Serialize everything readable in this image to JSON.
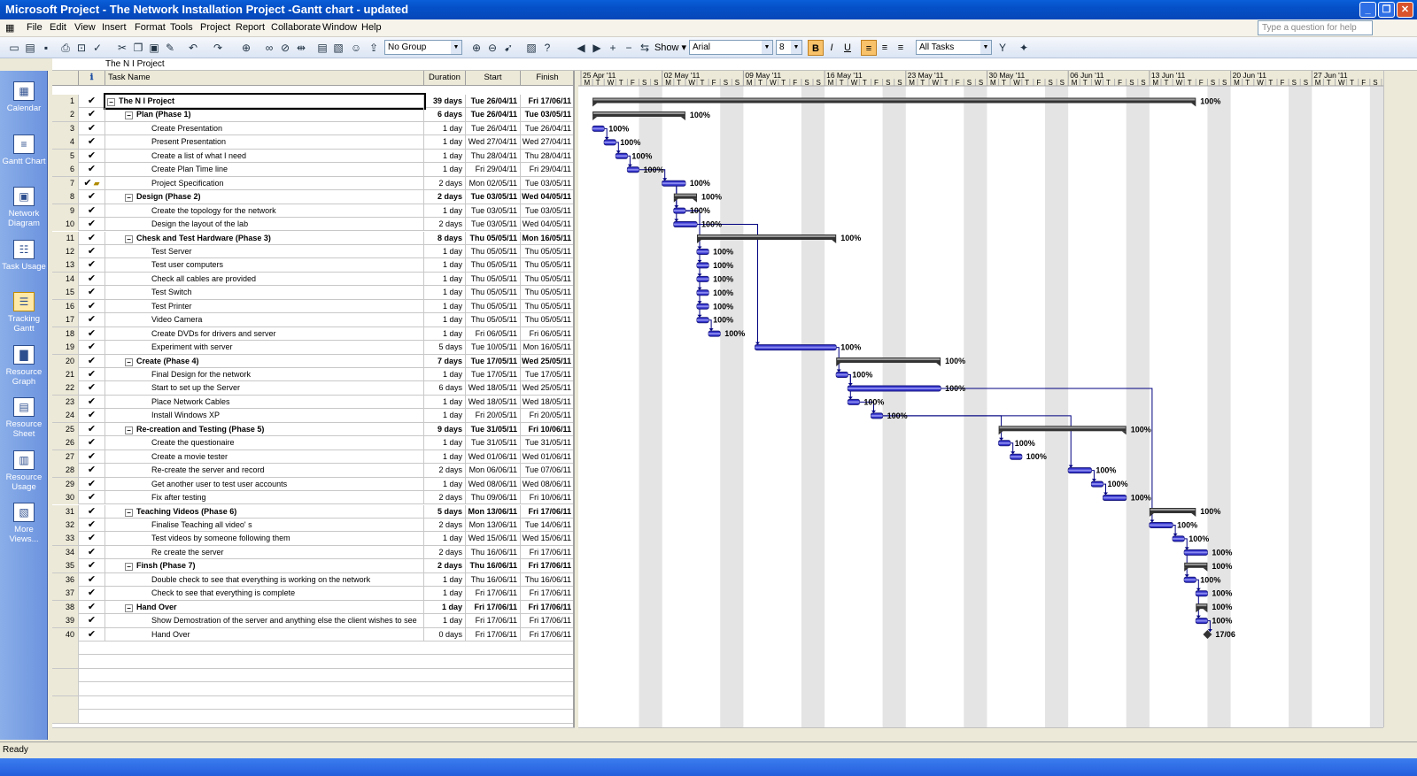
{
  "window": {
    "title": "Microsoft Project - The Network Installation Project -Gantt chart - updated"
  },
  "menu": [
    "File",
    "Edit",
    "View",
    "Insert",
    "Format",
    "Tools",
    "Project",
    "Report",
    "Collaborate",
    "Window",
    "Help"
  ],
  "help_placeholder": "Type a question for help",
  "toolbar": {
    "group_value": "No Group",
    "show_label": "Show ▾",
    "font": "Arial",
    "font_size": "8",
    "filter_value": "All Tasks",
    "bold": "B",
    "italic": "I",
    "underline": "U"
  },
  "entry_bar": "The N I Project",
  "view_bar": [
    {
      "label": "Calendar",
      "icon": "calendar-icon",
      "glyph": "▦"
    },
    {
      "label": "Gantt Chart",
      "icon": "gantt-chart-icon",
      "glyph": "≡"
    },
    {
      "label": "Network Diagram",
      "icon": "network-diagram-icon",
      "glyph": "▣"
    },
    {
      "label": "Task Usage",
      "icon": "task-usage-icon",
      "glyph": "☷"
    },
    {
      "label": "Tracking Gantt",
      "icon": "tracking-gantt-icon",
      "glyph": "☰"
    },
    {
      "label": "Resource Graph",
      "icon": "resource-graph-icon",
      "glyph": "▇"
    },
    {
      "label": "Resource Sheet",
      "icon": "resource-sheet-icon",
      "glyph": "▤"
    },
    {
      "label": "Resource Usage",
      "icon": "resource-usage-icon",
      "glyph": "▥"
    },
    {
      "label": "More Views...",
      "icon": "more-views-icon",
      "glyph": "▧"
    }
  ],
  "columns": {
    "info": "ℹ",
    "name": "Task Name",
    "duration": "Duration",
    "start": "Start",
    "finish": "Finish"
  },
  "weeks": [
    "25 Apr '11",
    "02 May '11",
    "09 May '11",
    "16 May '11",
    "23 May '11",
    "30 May '11",
    "06 Jun '11",
    "13 Jun '11",
    "20 Jun '11",
    "27 Jun '11"
  ],
  "day_letters": [
    "M",
    "T",
    "W",
    "T",
    "F",
    "S",
    "S"
  ],
  "tasks": [
    {
      "id": "1",
      "name": "The N I Project",
      "duration": "39 days",
      "start": "Tue 26/04/11",
      "finish": "Fri 17/06/11",
      "level": 0,
      "summary": true,
      "s": 1,
      "e": 53,
      "pct": "100%"
    },
    {
      "id": "2",
      "name": "Plan (Phase 1)",
      "duration": "6 days",
      "start": "Tue 26/04/11",
      "finish": "Tue 03/05/11",
      "level": 1,
      "summary": true,
      "s": 1,
      "e": 9,
      "pct": "100%"
    },
    {
      "id": "3",
      "name": "Create Presentation",
      "duration": "1 day",
      "start": "Tue 26/04/11",
      "finish": "Tue 26/04/11",
      "level": 2,
      "s": 1,
      "e": 2,
      "pct": "100%"
    },
    {
      "id": "4",
      "name": "Present Presentation",
      "duration": "1 day",
      "start": "Wed 27/04/11",
      "finish": "Wed 27/04/11",
      "level": 2,
      "s": 2,
      "e": 3,
      "pct": "100%"
    },
    {
      "id": "5",
      "name": "Create a list of what I need",
      "duration": "1 day",
      "start": "Thu 28/04/11",
      "finish": "Thu 28/04/11",
      "level": 2,
      "s": 3,
      "e": 4,
      "pct": "100%"
    },
    {
      "id": "6",
      "name": "Create Plan Time line",
      "duration": "1 day",
      "start": "Fri 29/04/11",
      "finish": "Fri 29/04/11",
      "level": 2,
      "s": 4,
      "e": 5,
      "pct": "100%"
    },
    {
      "id": "7",
      "name": "Project Specification",
      "duration": "2 days",
      "start": "Mon 02/05/11",
      "finish": "Tue 03/05/11",
      "level": 2,
      "note": true,
      "s": 7,
      "e": 9,
      "pct": "100%"
    },
    {
      "id": "8",
      "name": "Design (Phase 2)",
      "duration": "2 days",
      "start": "Tue 03/05/11",
      "finish": "Wed 04/05/11",
      "level": 1,
      "summary": true,
      "s": 8,
      "e": 10,
      "pct": "100%"
    },
    {
      "id": "9",
      "name": "Create the topology for the network",
      "duration": "1 day",
      "start": "Tue 03/05/11",
      "finish": "Tue 03/05/11",
      "level": 2,
      "s": 8,
      "e": 9,
      "pct": "100%"
    },
    {
      "id": "10",
      "name": "Design the layout of the lab",
      "duration": "2 days",
      "start": "Tue 03/05/11",
      "finish": "Wed 04/05/11",
      "level": 2,
      "s": 8,
      "e": 10,
      "pct": "100%"
    },
    {
      "id": "11",
      "name": "Chesk and Test Hardware (Phase 3)",
      "duration": "8 days",
      "start": "Thu 05/05/11",
      "finish": "Mon 16/05/11",
      "level": 1,
      "summary": true,
      "s": 10,
      "e": 22,
      "pct": "100%"
    },
    {
      "id": "12",
      "name": "Test Server",
      "duration": "1 day",
      "start": "Thu 05/05/11",
      "finish": "Thu 05/05/11",
      "level": 2,
      "s": 10,
      "e": 11,
      "pct": "100%"
    },
    {
      "id": "13",
      "name": "Test user computers",
      "duration": "1 day",
      "start": "Thu 05/05/11",
      "finish": "Thu 05/05/11",
      "level": 2,
      "s": 10,
      "e": 11,
      "pct": "100%"
    },
    {
      "id": "14",
      "name": "Check all cables are provided",
      "duration": "1 day",
      "start": "Thu 05/05/11",
      "finish": "Thu 05/05/11",
      "level": 2,
      "s": 10,
      "e": 11,
      "pct": "100%"
    },
    {
      "id": "15",
      "name": "Test Switch",
      "duration": "1 day",
      "start": "Thu 05/05/11",
      "finish": "Thu 05/05/11",
      "level": 2,
      "s": 10,
      "e": 11,
      "pct": "100%"
    },
    {
      "id": "16",
      "name": "Test Printer",
      "duration": "1 day",
      "start": "Thu 05/05/11",
      "finish": "Thu 05/05/11",
      "level": 2,
      "s": 10,
      "e": 11,
      "pct": "100%"
    },
    {
      "id": "17",
      "name": "Video Camera",
      "duration": "1 day",
      "start": "Thu 05/05/11",
      "finish": "Thu 05/05/11",
      "level": 2,
      "s": 10,
      "e": 11,
      "pct": "100%"
    },
    {
      "id": "18",
      "name": "Create DVDs for drivers and server",
      "duration": "1 day",
      "start": "Fri 06/05/11",
      "finish": "Fri 06/05/11",
      "level": 2,
      "s": 11,
      "e": 12,
      "pct": "100%"
    },
    {
      "id": "19",
      "name": "Experiment with server",
      "duration": "5 days",
      "start": "Tue 10/05/11",
      "finish": "Mon 16/05/11",
      "level": 2,
      "s": 15,
      "e": 22,
      "pct": "100%"
    },
    {
      "id": "20",
      "name": "Create (Phase 4)",
      "duration": "7 days",
      "start": "Tue 17/05/11",
      "finish": "Wed 25/05/11",
      "level": 1,
      "summary": true,
      "s": 22,
      "e": 31,
      "pct": "100%"
    },
    {
      "id": "21",
      "name": "Final Design for the network",
      "duration": "1 day",
      "start": "Tue 17/05/11",
      "finish": "Tue 17/05/11",
      "level": 2,
      "s": 22,
      "e": 23,
      "pct": "100%"
    },
    {
      "id": "22",
      "name": "Start to set up the Server",
      "duration": "6 days",
      "start": "Wed 18/05/11",
      "finish": "Wed 25/05/11",
      "level": 2,
      "s": 23,
      "e": 31,
      "pct": "100%"
    },
    {
      "id": "23",
      "name": "Place Network Cables",
      "duration": "1 day",
      "start": "Wed 18/05/11",
      "finish": "Wed 18/05/11",
      "level": 2,
      "s": 23,
      "e": 24,
      "pct": "100%"
    },
    {
      "id": "24",
      "name": "Install Windows XP",
      "duration": "1 day",
      "start": "Fri 20/05/11",
      "finish": "Fri 20/05/11",
      "level": 2,
      "s": 25,
      "e": 26,
      "pct": "100%"
    },
    {
      "id": "25",
      "name": "Re-creation and Testing (Phase 5)",
      "duration": "9 days",
      "start": "Tue 31/05/11",
      "finish": "Fri 10/06/11",
      "level": 1,
      "summary": true,
      "s": 36,
      "e": 47,
      "pct": "100%"
    },
    {
      "id": "26",
      "name": "Create the questionaire",
      "duration": "1 day",
      "start": "Tue 31/05/11",
      "finish": "Tue 31/05/11",
      "level": 2,
      "s": 36,
      "e": 37,
      "pct": "100%"
    },
    {
      "id": "27",
      "name": "Create a movie tester",
      "duration": "1 day",
      "start": "Wed 01/06/11",
      "finish": "Wed 01/06/11",
      "level": 2,
      "s": 37,
      "e": 38,
      "pct": "100%"
    },
    {
      "id": "28",
      "name": "Re-create the server and record",
      "duration": "2 days",
      "start": "Mon 06/06/11",
      "finish": "Tue 07/06/11",
      "level": 2,
      "s": 42,
      "e": 44,
      "pct": "100%"
    },
    {
      "id": "29",
      "name": "Get another user to test user accounts",
      "duration": "1 day",
      "start": "Wed 08/06/11",
      "finish": "Wed 08/06/11",
      "level": 2,
      "s": 44,
      "e": 45,
      "pct": "100%"
    },
    {
      "id": "30",
      "name": "Fix after testing",
      "duration": "2 days",
      "start": "Thu 09/06/11",
      "finish": "Fri 10/06/11",
      "level": 2,
      "s": 45,
      "e": 47,
      "pct": "100%"
    },
    {
      "id": "31",
      "name": "Teaching Videos (Phase 6)",
      "duration": "5 days",
      "start": "Mon 13/06/11",
      "finish": "Fri 17/06/11",
      "level": 1,
      "summary": true,
      "s": 49,
      "e": 53,
      "pct": "100%"
    },
    {
      "id": "32",
      "name": "Finalise Teaching all video' s",
      "duration": "2 days",
      "start": "Mon 13/06/11",
      "finish": "Tue 14/06/11",
      "level": 2,
      "s": 49,
      "e": 51,
      "pct": "100%"
    },
    {
      "id": "33",
      "name": "Test videos by someone following them",
      "duration": "1 day",
      "start": "Wed 15/06/11",
      "finish": "Wed 15/06/11",
      "level": 2,
      "s": 51,
      "e": 52,
      "pct": "100%"
    },
    {
      "id": "34",
      "name": " Re create the server",
      "duration": "2 days",
      "start": "Thu 16/06/11",
      "finish": "Fri 17/06/11",
      "level": 2,
      "s": 52,
      "e": 54,
      "pct": "100%"
    },
    {
      "id": "35",
      "name": "Finsh (Phase 7)",
      "duration": "2 days",
      "start": "Thu 16/06/11",
      "finish": "Fri 17/06/11",
      "level": 1,
      "summary": true,
      "s": 52,
      "e": 54,
      "pct": "100%"
    },
    {
      "id": "36",
      "name": "Double check to see that everything is working on the network",
      "duration": "1 day",
      "start": "Thu 16/06/11",
      "finish": "Thu 16/06/11",
      "level": 2,
      "s": 52,
      "e": 53,
      "pct": "100%"
    },
    {
      "id": "37",
      "name": "Check to see that everything is complete",
      "duration": "1 day",
      "start": "Fri 17/06/11",
      "finish": "Fri 17/06/11",
      "level": 2,
      "s": 53,
      "e": 54,
      "pct": "100%"
    },
    {
      "id": "38",
      "name": "Hand Over",
      "duration": "1 day",
      "start": "Fri 17/06/11",
      "finish": "Fri 17/06/11",
      "level": 1,
      "summary": true,
      "s": 53,
      "e": 54,
      "pct": "100%"
    },
    {
      "id": "39",
      "name": "Show Demostration of the server and anything else the client wishes to see",
      "duration": "1 day",
      "start": "Fri 17/06/11",
      "finish": "Fri 17/06/11",
      "level": 2,
      "s": 53,
      "e": 54,
      "pct": "100%"
    },
    {
      "id": "40",
      "name": "Hand Over",
      "duration": "0 days",
      "start": "Fri 17/06/11",
      "finish": "Fri 17/06/11",
      "level": 2,
      "milestone": true,
      "s": 54,
      "e": 54,
      "pct": "17/06"
    }
  ],
  "status": "Ready",
  "colors": {
    "bar": "#3333cc",
    "summary": "#333333",
    "weekend": "#e4e4e4",
    "link": "#000080"
  }
}
